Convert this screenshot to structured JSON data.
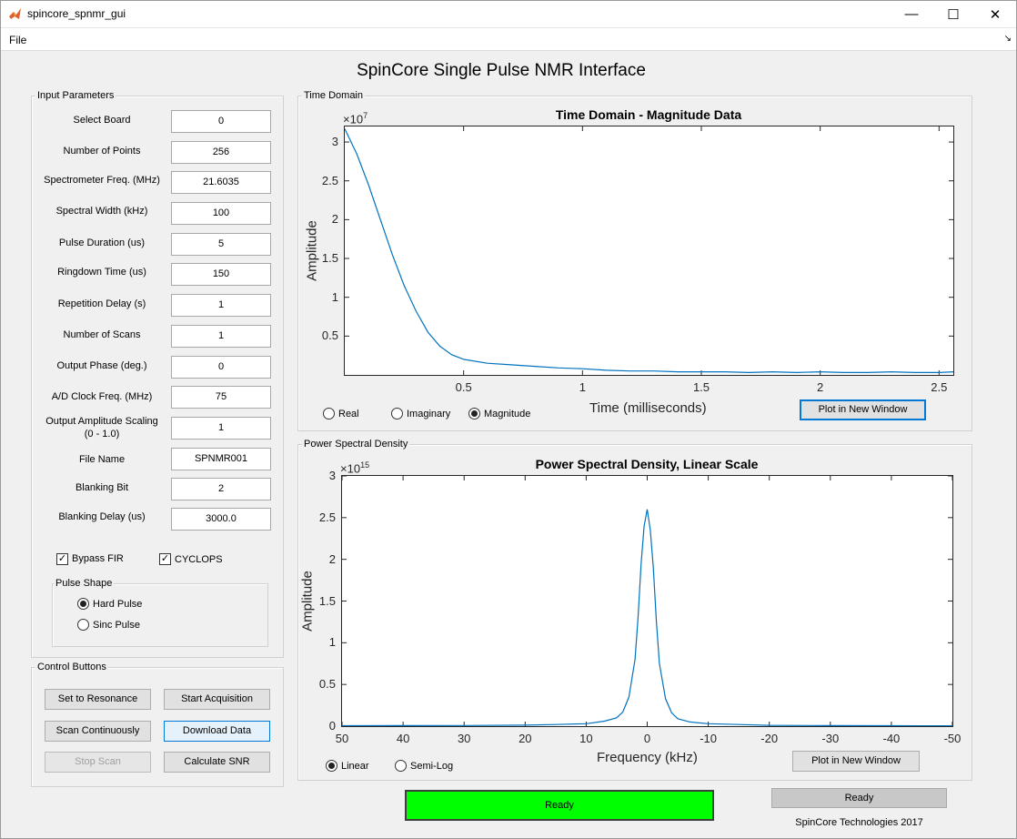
{
  "window": {
    "title": "spincore_spnmr_gui",
    "minimize": "—",
    "maximize": "☐",
    "close": "✕"
  },
  "menu": {
    "file": "File",
    "arrow": "↘"
  },
  "main_title": "SpinCore Single Pulse NMR Interface",
  "input_parameters": {
    "title": "Input Parameters",
    "fields": [
      {
        "label": "Select Board",
        "value": "0"
      },
      {
        "label": "Number of Points",
        "value": "256"
      },
      {
        "label": "Spectrometer Freq. (MHz)",
        "value": "21.6035"
      },
      {
        "label": "Spectral Width (kHz)",
        "value": "100"
      },
      {
        "label": "Pulse Duration (us)",
        "value": "5"
      },
      {
        "label": "Ringdown Time (us)",
        "value": "150"
      },
      {
        "label": "Repetition Delay (s)",
        "value": "1"
      },
      {
        "label": "Number of Scans",
        "value": "1"
      },
      {
        "label": "Output Phase (deg.)",
        "value": "0"
      },
      {
        "label": "A/D Clock Freq. (MHz)",
        "value": "75"
      },
      {
        "label": "Output Amplitude Scaling",
        "label2": "(0 - 1.0)",
        "value": "1"
      },
      {
        "label": "File Name",
        "value": "SPNMR001"
      },
      {
        "label": "Blanking Bit",
        "value": "2"
      },
      {
        "label": "Blanking Delay (us)",
        "value": "3000.0"
      }
    ],
    "bypass_fir": {
      "label": "Bypass FIR",
      "checked": true,
      "mark": "✓"
    },
    "cyclops": {
      "label": "CYCLOPS",
      "checked": true,
      "mark": "✓"
    },
    "pulse_shape": {
      "title": "Pulse Shape",
      "options": [
        {
          "label": "Hard Pulse",
          "selected": true
        },
        {
          "label": "Sinc Pulse",
          "selected": false
        }
      ]
    }
  },
  "control_buttons": {
    "title": "Control Buttons",
    "set_to_resonance": "Set to Resonance",
    "start_acquisition": "Start Acquisition",
    "scan_continuously": "Scan Continuously",
    "download_data": "Download Data",
    "stop_scan": "Stop Scan",
    "calculate_snr": "Calculate SNR"
  },
  "time_domain": {
    "panel_title": "Time Domain",
    "modes": [
      {
        "label": "Real",
        "selected": false
      },
      {
        "label": "Imaginary",
        "selected": false
      },
      {
        "label": "Magnitude",
        "selected": true
      }
    ],
    "plot_button": "Plot in New Window"
  },
  "psd": {
    "panel_title": "Power Spectral Density",
    "modes": [
      {
        "label": "Linear",
        "selected": true
      },
      {
        "label": "Semi-Log",
        "selected": false
      }
    ],
    "plot_button": "Plot in New Window"
  },
  "status": {
    "main": "Ready",
    "secondary": "Ready",
    "footer": "SpinCore Technologies 2017",
    "main_color": "#00ff00"
  },
  "chart_data": [
    {
      "type": "line",
      "title": "Time Domain - Magnitude Data",
      "xlabel": "Time (milliseconds)",
      "ylabel": "Amplitude",
      "exponent": "× 10^7",
      "exp_base": "×10",
      "exp_power": "7",
      "xlim": [
        0,
        2.56
      ],
      "ylim": [
        0,
        3.2
      ],
      "xticks": [
        0.5,
        1,
        1.5,
        2,
        2.5
      ],
      "xtick_labels": [
        "0.5",
        "1",
        "1.5",
        "2",
        "2.5"
      ],
      "yticks": [
        0.5,
        1,
        1.5,
        2,
        2.5,
        3
      ],
      "ytick_labels": [
        "0.5",
        "1",
        "1.5",
        "2",
        "2.5",
        "3"
      ],
      "color": "#0072bd",
      "series": [
        {
          "x": [
            0,
            0.05,
            0.1,
            0.15,
            0.2,
            0.25,
            0.3,
            0.35,
            0.4,
            0.45,
            0.5,
            0.6,
            0.7,
            0.8,
            0.9,
            1.0,
            1.1,
            1.2,
            1.3,
            1.4,
            1.5,
            1.6,
            1.7,
            1.8,
            1.9,
            2.0,
            2.1,
            2.2,
            2.3,
            2.4,
            2.5,
            2.56
          ],
          "y": [
            3.17,
            2.85,
            2.45,
            2.0,
            1.55,
            1.15,
            0.82,
            0.55,
            0.37,
            0.26,
            0.2,
            0.15,
            0.13,
            0.11,
            0.09,
            0.08,
            0.06,
            0.05,
            0.05,
            0.04,
            0.04,
            0.04,
            0.03,
            0.04,
            0.03,
            0.04,
            0.03,
            0.03,
            0.04,
            0.03,
            0.03,
            0.04
          ]
        }
      ]
    },
    {
      "type": "line",
      "title": "Power Spectral Density, Linear Scale",
      "xlabel": "Frequency (kHz)",
      "ylabel": "Amplitude",
      "exponent": "× 10^15",
      "exp_base": "×10",
      "exp_power": "15",
      "xlim": [
        50,
        -50
      ],
      "ylim": [
        0,
        3
      ],
      "xticks": [
        50,
        40,
        30,
        20,
        10,
        0,
        -10,
        -20,
        -30,
        -40,
        -50
      ],
      "xtick_labels": [
        "50",
        "40",
        "30",
        "20",
        "10",
        "0",
        "-10",
        "-20",
        "-30",
        "-40",
        "-50"
      ],
      "yticks": [
        0,
        0.5,
        1,
        1.5,
        2,
        2.5,
        3
      ],
      "ytick_labels": [
        "0",
        "0.5",
        "1",
        "1.5",
        "2",
        "2.5",
        "3"
      ],
      "color": "#0072bd",
      "series": [
        {
          "x": [
            50,
            40,
            30,
            20,
            15,
            10,
            7,
            5,
            4,
            3,
            2,
            1.5,
            1,
            0.5,
            0,
            -0.5,
            -1,
            -1.5,
            -2,
            -3,
            -4,
            -5,
            -7,
            -10,
            -15,
            -20,
            -30,
            -40,
            -50
          ],
          "y": [
            0.005,
            0.006,
            0.008,
            0.012,
            0.02,
            0.03,
            0.06,
            0.1,
            0.17,
            0.35,
            0.8,
            1.3,
            1.95,
            2.4,
            2.6,
            2.35,
            1.9,
            1.25,
            0.75,
            0.33,
            0.16,
            0.09,
            0.05,
            0.03,
            0.02,
            0.01,
            0.007,
            0.005,
            0.004
          ]
        }
      ]
    }
  ]
}
